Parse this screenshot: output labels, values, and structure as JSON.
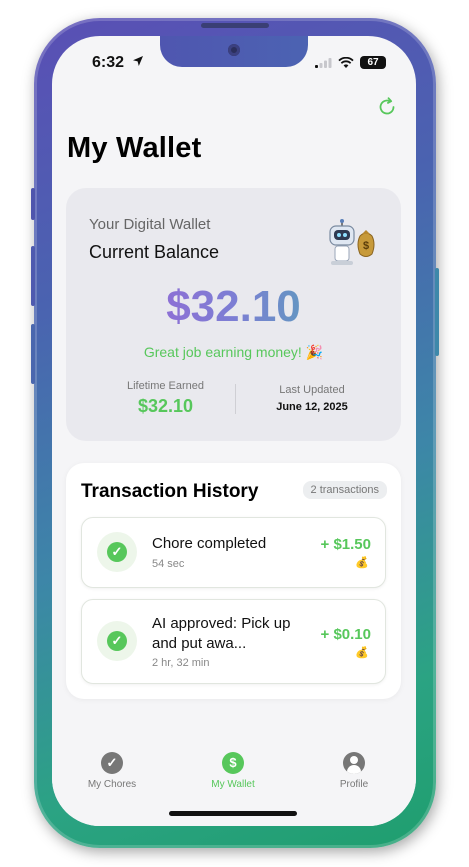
{
  "status_bar": {
    "time": "6:32",
    "battery": "67"
  },
  "page": {
    "title": "My Wallet"
  },
  "wallet": {
    "subtitle": "Your Digital Wallet",
    "title": "Current Balance",
    "balance": "$32.10",
    "encouragement": "Great job earning money! 🎉",
    "lifetime_label": "Lifetime Earned",
    "lifetime_value": "$32.10",
    "updated_label": "Last Updated",
    "updated_value": "June 12, 2025"
  },
  "transactions": {
    "heading": "Transaction History",
    "count": "2 transactions",
    "items": [
      {
        "title": "Chore completed",
        "time": "54 sec",
        "amount": "+ $1.50",
        "icon": "money-bag-icon"
      },
      {
        "title": "AI approved: Pick up and put awa...",
        "time": "2 hr, 32 min",
        "amount": "+ $0.10",
        "icon": "money-bag-icon"
      }
    ]
  },
  "tabs": [
    {
      "label": "My Chores",
      "icon": "check-icon",
      "color": "#777777"
    },
    {
      "label": "My Wallet",
      "icon": "dollar-icon",
      "color": "#57c75b",
      "active": true
    },
    {
      "label": "Profile",
      "icon": "person-icon",
      "color": "#777777"
    }
  ],
  "colors": {
    "accent": "#57c75b",
    "balance_start": "#a35cd6",
    "balance_end": "#3fb7a8"
  }
}
